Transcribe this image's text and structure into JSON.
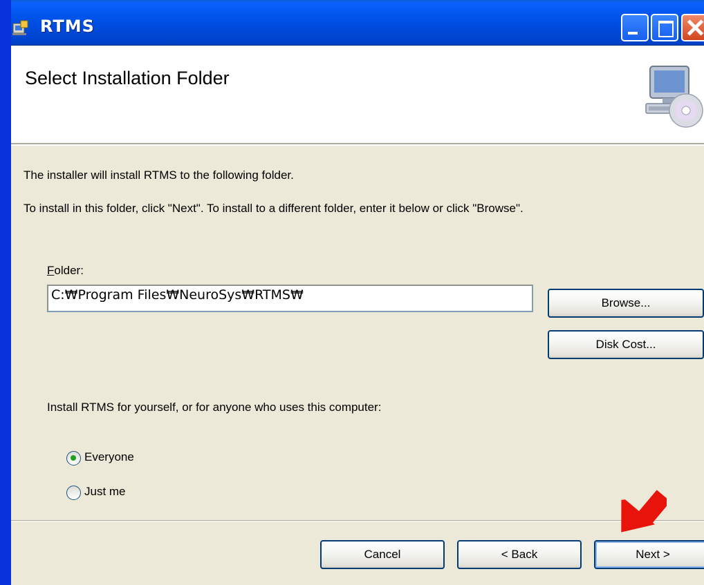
{
  "window": {
    "title": "RTMS"
  },
  "banner": {
    "title": "Select Installation Folder"
  },
  "main": {
    "intro_line1": "The installer will install RTMS to the following folder.",
    "intro_line2": "To install in this folder, click \"Next\". To install to a different folder, enter it below or click \"Browse\".",
    "folder_label_accel": "F",
    "folder_label_rest": "older:",
    "folder_value": "C:₩Program Files₩NeuroSys₩RTMS₩",
    "browse_label": "Browse...",
    "disk_cost_label": "Disk Cost...",
    "install_for_text": "Install RTMS for yourself, or for anyone who uses this computer:",
    "radio_options": [
      {
        "label": "Everyone",
        "selected": true
      },
      {
        "label": "Just me",
        "selected": false
      }
    ]
  },
  "footer": {
    "cancel_label": "Cancel",
    "back_label": "< Back",
    "next_label": "Next >"
  },
  "colors": {
    "titlebar": "#0053e8",
    "window_bg": "#ece9d8",
    "annotation_arrow": "#e8140c"
  },
  "icons": {
    "title_icon": "installer-icon",
    "banner_icon": "computer-cd-icon",
    "annotation": "red-arrow-icon"
  }
}
